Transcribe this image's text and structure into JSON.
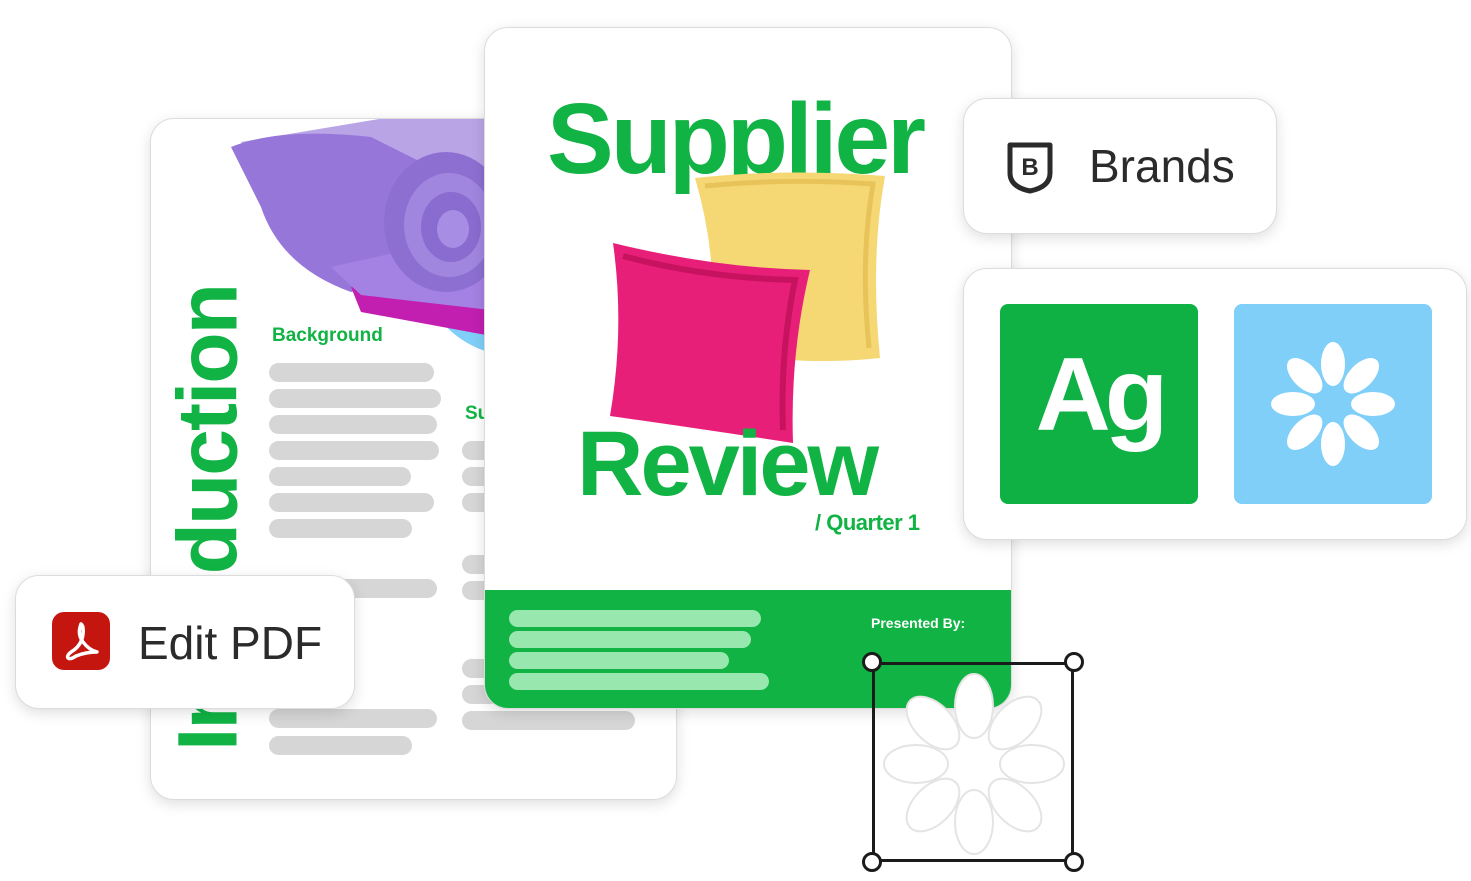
{
  "back_document": {
    "title": "Introduction",
    "section_background": "Background",
    "section_second_partial": "Su"
  },
  "front_document": {
    "title_line1": "Supplier",
    "title_line2": "Review",
    "subtitle": "/ Quarter 1",
    "presented_by": "Presented By:"
  },
  "brands_card": {
    "label": "Brands",
    "icon": "brand-shield-icon"
  },
  "assets_card": {
    "font_tile_text": "Ag",
    "logo_tile_icon": "flower-logo-icon"
  },
  "edit_card": {
    "label": "Edit PDF",
    "icon": "acrobat-pdf-icon"
  },
  "colors": {
    "brand_green": "#10b344",
    "light_blue": "#7fcff9",
    "acrobat_red": "#c5150f"
  }
}
